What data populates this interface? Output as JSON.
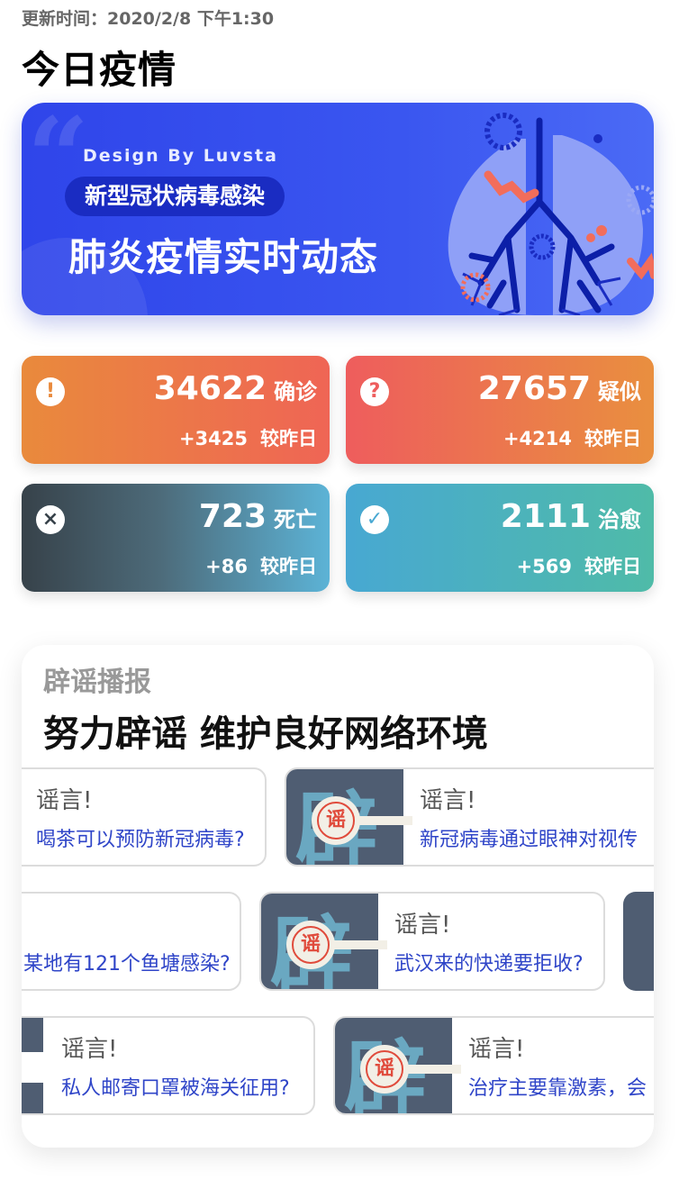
{
  "header": {
    "update_time": "更新时间：2020/2/8 下午1:30",
    "title": "今日疫情"
  },
  "banner": {
    "quote_mark": "“",
    "design_by": "Design By Luvsta",
    "pill": "新型冠状病毒感染",
    "headline": "肺炎疫情实时动态"
  },
  "stats": {
    "confirmed": {
      "icon": "!",
      "value": "34622",
      "label": "确诊",
      "delta": "+3425",
      "compare": "较昨日",
      "color": "#e98a3c"
    },
    "suspected": {
      "icon": "?",
      "value": "27657",
      "label": "疑似",
      "delta": "+4214",
      "compare": "较昨日",
      "color": "#ee5d5d"
    },
    "dead": {
      "icon": "×",
      "value": "723",
      "label": "死亡",
      "delta": "+86",
      "compare": "较昨日",
      "color": "#37424a"
    },
    "cured": {
      "icon": "✓",
      "value": "2111",
      "label": "治愈",
      "delta": "+569",
      "compare": "较昨日",
      "color": "#48a8d2"
    }
  },
  "rumors": {
    "section_title": "辟谣播报",
    "section_subtitle": "努力辟谣 维护良好网络环境",
    "thumb_char": "辟",
    "seal_char": "谣",
    "rows": [
      [
        {
          "head": "谣言!",
          "text": "喝茶可以预防新冠病毒?"
        },
        {
          "head": "谣言!",
          "text": "新冠病毒通过眼神对视传"
        }
      ],
      [
        {
          "head": "",
          "text": "某地有121个鱼塘感染?"
        },
        {
          "head": "谣言!",
          "text": "武汉来的快递要拒收?"
        }
      ],
      [
        {
          "head": "谣言!",
          "text": "私人邮寄口罩被海关征用?"
        },
        {
          "head": "谣言!",
          "text": "治疗主要靠激素，会"
        }
      ]
    ]
  }
}
